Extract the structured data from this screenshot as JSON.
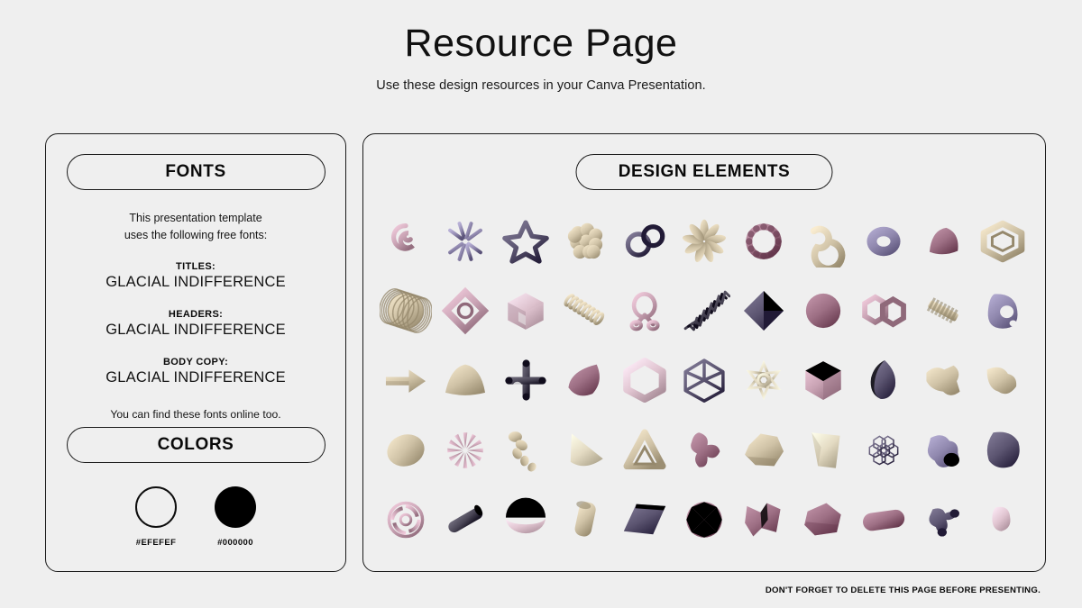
{
  "header": {
    "title": "Resource Page",
    "subtitle": "Use these design resources in your Canva Presentation."
  },
  "fonts_panel": {
    "heading": "FONTS",
    "intro_line1": "This presentation template",
    "intro_line2": "uses the following free fonts:",
    "entries": [
      {
        "role": "TITLES:",
        "font": "GLACIAL INDIFFERENCE"
      },
      {
        "role": "HEADERS:",
        "font": "GLACIAL INDIFFERENCE"
      },
      {
        "role": "BODY COPY:",
        "font": "GLACIAL INDIFFERENCE"
      }
    ],
    "outro": "You can find these fonts online too."
  },
  "colors_panel": {
    "heading": "COLORS",
    "swatches": [
      {
        "label": "#EFEFEF",
        "hex": "#EFEFEF",
        "style": "outline"
      },
      {
        "label": "#000000",
        "hex": "#000000",
        "style": "filled"
      }
    ]
  },
  "elements_panel": {
    "heading": "DESIGN ELEMENTS",
    "grid": {
      "rows": 5,
      "columns": 11
    },
    "palette": {
      "beige": "#cfc2a6",
      "beige_light": "#e3dac2",
      "pink": "#c9a3b4",
      "pink_light": "#e0c4d0",
      "mauve": "#9d6f84",
      "purple": "#8f87ad",
      "purple_dark": "#5b5470",
      "charcoal": "#4a4656"
    },
    "shapes": [
      {
        "name": "spiral-swirl",
        "color": "pink"
      },
      {
        "name": "starburst-spokes",
        "color": "purple"
      },
      {
        "name": "outline-star",
        "color": "purple_dark"
      },
      {
        "name": "bubble-cluster",
        "color": "beige"
      },
      {
        "name": "linked-rings",
        "color": "purple_dark"
      },
      {
        "name": "petal-flower",
        "color": "beige"
      },
      {
        "name": "twisted-ring",
        "color": "mauve"
      },
      {
        "name": "curled-swirl",
        "color": "beige"
      },
      {
        "name": "torus-donut",
        "color": "purple"
      },
      {
        "name": "rounded-wedge",
        "color": "mauve"
      },
      {
        "name": "hexagon-frame",
        "color": "beige"
      },
      {
        "name": "yarn-sphere",
        "color": "beige"
      },
      {
        "name": "diamond-ring-frame",
        "color": "pink"
      },
      {
        "name": "notched-cube",
        "color": "pink_light"
      },
      {
        "name": "coil-spring",
        "color": "beige"
      },
      {
        "name": "loop-knot",
        "color": "pink"
      },
      {
        "name": "zigzag-scribble",
        "color": "charcoal"
      },
      {
        "name": "pyramid-diamond",
        "color": "purple_dark"
      },
      {
        "name": "striped-sphere",
        "color": "mauve"
      },
      {
        "name": "hexagon-links",
        "color": "pink"
      },
      {
        "name": "screw-bolt",
        "color": "beige"
      },
      {
        "name": "pierced-blob",
        "color": "purple"
      },
      {
        "name": "block-arrow",
        "color": "beige"
      },
      {
        "name": "smooth-mound",
        "color": "beige"
      },
      {
        "name": "tube-cross",
        "color": "charcoal"
      },
      {
        "name": "teardrop-cone",
        "color": "mauve"
      },
      {
        "name": "hexagon-ring",
        "color": "pink_light"
      },
      {
        "name": "wireframe-cube",
        "color": "purple_dark"
      },
      {
        "name": "star-lattice",
        "color": "beige_light"
      },
      {
        "name": "isometric-cube",
        "color": "pink"
      },
      {
        "name": "gem-drop",
        "color": "purple_dark"
      },
      {
        "name": "chunky-arrow",
        "color": "beige"
      },
      {
        "name": "bent-form",
        "color": "beige"
      },
      {
        "name": "egg-ellipse",
        "color": "beige"
      },
      {
        "name": "spiky-star",
        "color": "pink"
      },
      {
        "name": "squiggle-chain",
        "color": "beige"
      },
      {
        "name": "tilted-cone",
        "color": "beige_light"
      },
      {
        "name": "triangle-knot",
        "color": "beige"
      },
      {
        "name": "organic-branch",
        "color": "mauve"
      },
      {
        "name": "faceted-rock",
        "color": "beige"
      },
      {
        "name": "folded-wedge",
        "color": "beige_light"
      },
      {
        "name": "mesh-lattice",
        "color": "purple_dark"
      },
      {
        "name": "lumpy-blob",
        "color": "purple"
      },
      {
        "name": "rounded-polygon",
        "color": "purple_dark"
      },
      {
        "name": "gear-wheel",
        "color": "pink"
      },
      {
        "name": "angled-cylinder",
        "color": "charcoal"
      },
      {
        "name": "half-dome",
        "color": "pink_light"
      },
      {
        "name": "hollow-tube",
        "color": "beige"
      },
      {
        "name": "parallelogram-slab",
        "color": "purple_dark"
      },
      {
        "name": "faceted-sphere",
        "color": "mauve"
      },
      {
        "name": "crumpled-form",
        "color": "mauve"
      },
      {
        "name": "angular-stone",
        "color": "mauve"
      },
      {
        "name": "capsule-pill",
        "color": "mauve"
      },
      {
        "name": "splash-blob",
        "color": "purple_dark"
      },
      {
        "name": "small-nub",
        "color": "pink_light"
      }
    ]
  },
  "footer": {
    "note": "DON'T FORGET TO DELETE THIS PAGE BEFORE PRESENTING."
  }
}
